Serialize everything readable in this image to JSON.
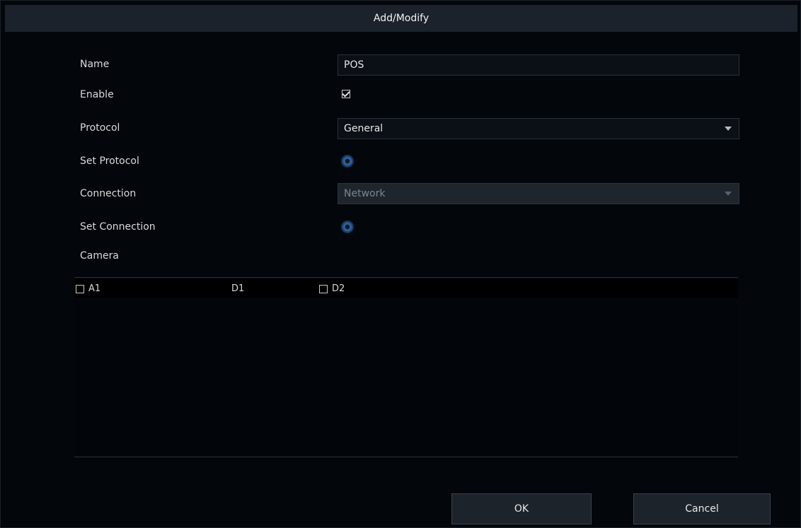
{
  "dialog": {
    "title": "Add/Modify"
  },
  "form": {
    "name_label": "Name",
    "name_value": "POS",
    "enable_label": "Enable",
    "enable_checked": true,
    "protocol_label": "Protocol",
    "protocol_value": "General",
    "set_protocol_label": "Set Protocol",
    "connection_label": "Connection",
    "connection_value": "Network",
    "set_connection_label": "Set Connection",
    "camera_label": "Camera"
  },
  "cameras": [
    {
      "label": "A1",
      "checked": false
    },
    {
      "label": "D1",
      "checked": false
    },
    {
      "label": "D2",
      "checked": false
    }
  ],
  "buttons": {
    "ok_label": "OK",
    "cancel_label": "Cancel"
  },
  "colors": {
    "background": "#03070c",
    "titlebar": "#1c222b",
    "accent": "#2e5f9c"
  },
  "icons": {
    "set_protocol": "gear-icon",
    "set_connection": "gear-icon",
    "dropdown": "chevron-down-icon"
  }
}
